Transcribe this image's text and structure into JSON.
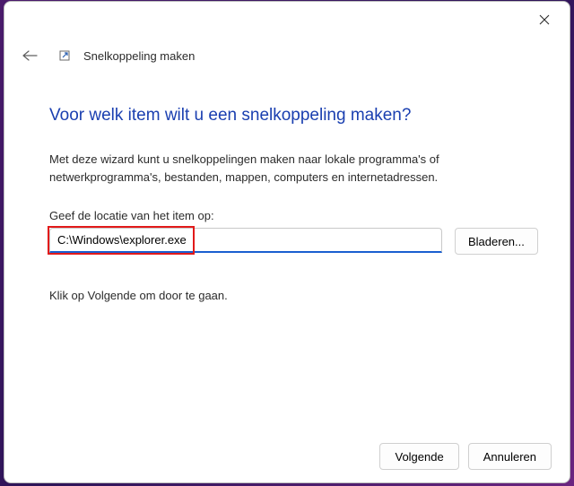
{
  "header": {
    "title": "Snelkoppeling maken"
  },
  "main": {
    "heading": "Voor welk item wilt u een snelkoppeling maken?",
    "description": "Met deze wizard kunt u snelkoppelingen maken naar lokale programma's of netwerkprogramma's, bestanden, mappen, computers en internetadressen.",
    "field_label": "Geef de locatie van het item op:",
    "input_value": "C:\\Windows\\explorer.exe",
    "browse_label": "Bladeren...",
    "hint": "Klik op Volgende om door te gaan."
  },
  "footer": {
    "next": "Volgende",
    "cancel": "Annuleren"
  }
}
